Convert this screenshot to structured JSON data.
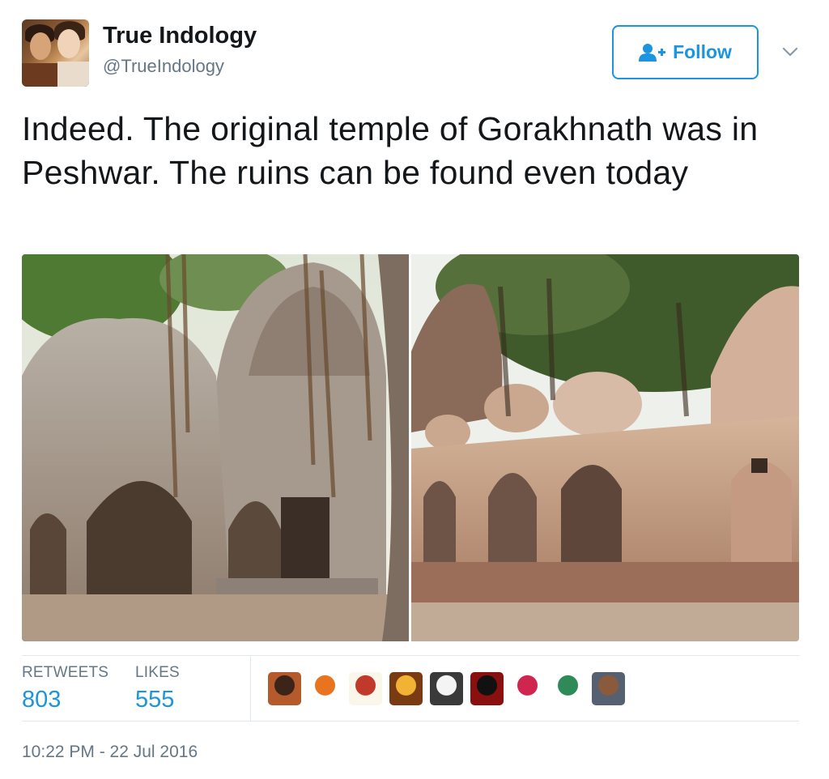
{
  "author": {
    "name": "True Indology",
    "handle": "@TrueIndology",
    "avatar_icon": "avatar-painting"
  },
  "follow_button": {
    "label": "Follow",
    "icon": "add-user-icon",
    "color": "#1b95e0"
  },
  "menu": {
    "icon": "chevron-down-icon"
  },
  "tweet": {
    "text": "Indeed. The original temple of Gorakhnath was in Peshwar. The ruins can be found even today"
  },
  "media": {
    "photos": [
      {
        "icon": "temple-ruins-photo-left"
      },
      {
        "icon": "temple-ruins-photo-right"
      }
    ]
  },
  "stats": {
    "retweets_label": "RETWEETS",
    "retweets_value": "803",
    "likes_label": "LIKES",
    "likes_value": "555"
  },
  "likers": [
    {
      "name": "liker-avatar-1",
      "colors": [
        "#b55a2a",
        "#3d2418"
      ]
    },
    {
      "name": "liker-avatar-2",
      "colors": [
        "#ffffff",
        "#e8741f"
      ]
    },
    {
      "name": "liker-avatar-3",
      "colors": [
        "#fbf6ea",
        "#c0392b"
      ]
    },
    {
      "name": "liker-avatar-4",
      "colors": [
        "#7a3b12",
        "#f2b233"
      ]
    },
    {
      "name": "liker-avatar-5",
      "colors": [
        "#3a3a3a",
        "#f4f4f4"
      ]
    },
    {
      "name": "liker-avatar-6",
      "colors": [
        "#8a1010",
        "#111111"
      ]
    },
    {
      "name": "liker-avatar-7",
      "colors": [
        "#ffffff",
        "#d0254f"
      ]
    },
    {
      "name": "liker-avatar-8",
      "colors": [
        "#ffffff",
        "#2e8b57"
      ]
    },
    {
      "name": "liker-avatar-9",
      "colors": [
        "#556070",
        "#8a5a3c"
      ]
    }
  ],
  "timestamp": "10:22 PM - 22 Jul 2016"
}
